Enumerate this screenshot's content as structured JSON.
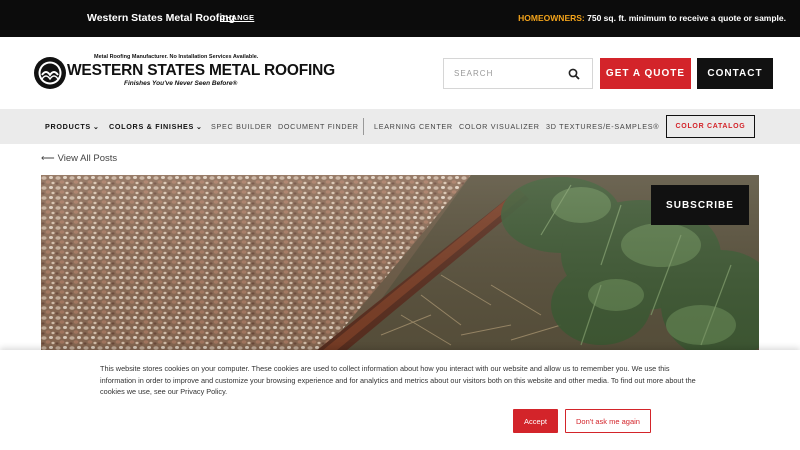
{
  "topbar": {
    "store_name": "Western States Metal Roofing",
    "change_label": "CHANGE",
    "homeowners_label": "HOMEOWNERS:",
    "homeowners_text": " 750 sq. ft. minimum to receive a quote or sample."
  },
  "header": {
    "logo": {
      "tagline": "Metal Roofing Manufacturer. No Installation Services Available.",
      "name": "WESTERN STATES METAL ROOFING",
      "slogan": "Finishes You've Never Seen Before®"
    },
    "search": {
      "placeholder": "SEARCH",
      "value": ""
    },
    "quote_label": "GET A QUOTE",
    "contact_label": "CONTACT"
  },
  "nav": {
    "items": [
      {
        "label": "PRODUCTS",
        "dropdown": true
      },
      {
        "label": "COLORS & FINISHES",
        "dropdown": true
      },
      {
        "label": "SPEC BUILDER"
      },
      {
        "label": "DOCUMENT FINDER"
      },
      {
        "label": "LEARNING CENTER"
      },
      {
        "label": "COLOR VISUALIZER"
      },
      {
        "label": "3D TEXTURES/E-SAMPLES®"
      }
    ],
    "catalog_label": "COLOR CATALOG"
  },
  "back_link": {
    "label": "View All Posts",
    "icon": "arrow-left-icon"
  },
  "hero": {
    "subscribe_label": "SUBSCRIBE"
  },
  "cookie": {
    "text": "This website stores cookies on your computer. These cookies are used to collect information about how you interact with our website and allow us to remember you. We use this information in order to improve and customize your browsing experience and for analytics and metrics about our visitors both on this website and other media. To find out more about the cookies we use, see our Privacy Policy.",
    "accept_label": "Accept",
    "decline_label": "Don't ask me again"
  },
  "colors": {
    "brand_red": "#d3242a",
    "topbar_bg": "#0c0c0c",
    "highlight_orange": "#f2a31b",
    "nav_bg": "#ebebeb"
  }
}
